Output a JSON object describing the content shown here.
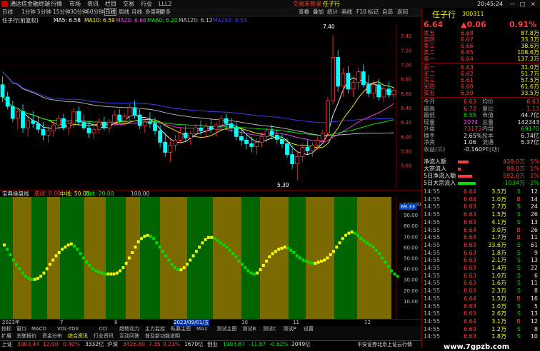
{
  "app": {
    "title": "通达信金融终端",
    "window_controls": [
      "—",
      "□",
      "×"
    ]
  },
  "menu": [
    "行情",
    "市场",
    "资讯",
    "栏目",
    "交易",
    "行业",
    "LLL2"
  ],
  "login": {
    "label": "交易未登录",
    "stock_label": "任子行"
  },
  "toolbar": {
    "items": [
      "日线",
      "1分钟",
      "5分钟",
      "15分钟",
      "30分钟",
      "60分钟",
      "日线",
      "周线",
      "月线",
      "多周期",
      "更多"
    ],
    "right_items": [
      "查看",
      "叠加",
      "统计",
      "画线",
      "F10",
      "标记",
      "自选",
      "返回"
    ]
  },
  "stock": {
    "name": "任子行",
    "code": "300311",
    "header_label": "任子行(前复权)"
  },
  "ma_legend": [
    {
      "label": "MA5: 6.58",
      "color": "#ffffff"
    },
    {
      "label": "MA10: 6.59",
      "color": "#ffff00"
    },
    {
      "label": "MA20: 6.66",
      "color": "#ff40ff"
    },
    {
      "label": "MA60: 6.20",
      "color": "#00ff00"
    },
    {
      "label": "MA120: 6.12",
      "color": "#c0c0c0"
    },
    {
      "label": "MA250: 6.54",
      "color": "#4040ff"
    }
  ],
  "price_axis": [
    "7.40",
    "7.20",
    "7.00",
    "6.80",
    "6.60",
    "6.40",
    "6.20",
    "6.00",
    "5.80",
    "5.60"
  ],
  "annotations": {
    "high": "7.40",
    "low": "5.39"
  },
  "indicator": {
    "name": "宝典操盘线",
    "legend": [
      {
        "label": "底线: 0.00",
        "color": "#ff3b3b"
      },
      {
        "label": "中线: 50.00",
        "color": "#ffff00"
      },
      {
        "label": "顶线: 20.00",
        "color": "#00ff00"
      },
      {
        "label": "100.00",
        "color": "#c0c0c0"
      }
    ],
    "axis": [
      "100.00",
      "90.00",
      "80.00",
      "70.00",
      "60.00",
      "50.00",
      "40.00",
      "30.00",
      "20.00",
      "10.00"
    ],
    "tag": "69.33"
  },
  "time_axis": {
    "labels": [
      "2023年",
      "7",
      "8",
      "2023/09/01/五",
      "10",
      "11",
      "12"
    ]
  },
  "tabs": [
    "指标",
    "窗口",
    "MACD",
    "VOL-TDX",
    "CCI",
    "趋势动力",
    "主力监控",
    "私募主图",
    "MA2",
    "测试主图",
    "测试B",
    "测试C",
    "测试P",
    "设置"
  ],
  "tabs2": [
    "扩展",
    "关联报价",
    "资金分布",
    "综合资讯",
    "行业资讯",
    "互动问答",
    "普及新功能说明"
  ],
  "quote": {
    "price": "6.64",
    "change": "▲0.06",
    "pct": "0.91%",
    "asks": [
      {
        "label": "卖五",
        "price": "6.68",
        "vol": "87.8万"
      },
      {
        "label": "卖四",
        "price": "6.67",
        "vol": "33.3万"
      },
      {
        "label": "卖三",
        "price": "6.66",
        "vol": "38.6万"
      },
      {
        "label": "卖二",
        "price": "6.65",
        "vol": "108.6万"
      },
      {
        "label": "卖一",
        "price": "6.64",
        "vol": "137.3万"
      }
    ],
    "bids": [
      {
        "label": "买一",
        "price": "6.63",
        "vol": "31.0万"
      },
      {
        "label": "买二",
        "price": "6.62",
        "vol": "51.7万"
      },
      {
        "label": "买三",
        "price": "6.61",
        "vol": "57.5万"
      },
      {
        "label": "买四",
        "price": "6.60",
        "vol": "61.6万"
      },
      {
        "label": "买五",
        "price": "6.59",
        "vol": "33.5万"
      }
    ],
    "stats": [
      {
        "l1": "今开",
        "v1": "6.63",
        "c1": "red",
        "l2": "均价",
        "v2": "6.63",
        "c2": "red"
      },
      {
        "l1": "最高",
        "v1": "6.72",
        "c1": "red",
        "l2": "量比",
        "v2": "1.13",
        "c2": "red"
      },
      {
        "l1": "最低",
        "v1": "6.55",
        "c1": "green",
        "l2": "市值",
        "v2": "44.7亿",
        "c2": "white"
      },
      {
        "l1": "现量",
        "v1": "2074",
        "c1": "mag",
        "l2": "总量",
        "v2": "142343",
        "c2": "white"
      },
      {
        "l1": "外盘",
        "v1": "73173",
        "c1": "red",
        "l2": "内盘",
        "v2": "69170",
        "c2": "green"
      },
      {
        "l1": "换手",
        "v1": "2.65%",
        "c1": "white",
        "l2": "股本",
        "v2": "6.74亿",
        "c2": "white"
      },
      {
        "l1": "净资",
        "v1": "1.06",
        "c1": "white",
        "l2": "流通",
        "v2": "5.37亿",
        "c2": "white"
      },
      {
        "l1": "收益(三)",
        "v1": "-0.160",
        "c1": "white",
        "l2": "PE(动)",
        "v2": "",
        "c2": "white"
      }
    ],
    "flows": [
      {
        "label": "净流入额",
        "value": "438.0万",
        "pct": "5%",
        "color": "#ff3b3b",
        "frac": 0.55
      },
      {
        "label": "大宗流入",
        "value": "98.0万",
        "pct": "1%",
        "color": "#ff3b3b",
        "frac": 0.15
      },
      {
        "label": "5日净流入额",
        "value": "592.6万",
        "pct": "1%",
        "color": "#ff3b3b",
        "frac": 0.7
      },
      {
        "label": "5日大宗流入",
        "value": "-1034万",
        "pct": "-2%",
        "color": "#00e000",
        "frac": 0.9
      }
    ]
  },
  "ticks": [
    {
      "t": "14:55",
      "p": "6.64",
      "v": "3.5万",
      "d": "S",
      "n": "12"
    },
    {
      "t": "14:55",
      "p": "6.64",
      "v": "1.0万",
      "d": "B",
      "n": "14"
    },
    {
      "t": "14:55",
      "p": "6.63",
      "v": "2.7万",
      "d": "S",
      "n": "24"
    },
    {
      "t": "14:55",
      "p": "6.63",
      "v": "1.5万",
      "d": "S",
      "n": "26"
    },
    {
      "t": "14:55",
      "p": "6.63",
      "v": "4.1万",
      "d": "S",
      "n": "13"
    },
    {
      "t": "14:55",
      "p": "6.64",
      "v": "3.0万",
      "d": "B",
      "n": "26"
    },
    {
      "t": "14:55",
      "p": "6.64",
      "v": "1.7万",
      "d": "B",
      "n": "11"
    },
    {
      "t": "14:55",
      "p": "6.63",
      "v": "33.6万",
      "d": "S",
      "n": "61"
    },
    {
      "t": "14:55",
      "p": "6.63",
      "v": "1.8万",
      "d": "S",
      "n": "9"
    },
    {
      "t": "14:55",
      "p": "6.63",
      "v": "2.1万",
      "d": "S",
      "n": "13"
    },
    {
      "t": "14:55",
      "p": "6.63",
      "v": "1.4万",
      "d": "S",
      "n": "22"
    },
    {
      "t": "14:55",
      "p": "6.63",
      "v": "1.0万",
      "d": "S",
      "n": "6"
    },
    {
      "t": "14:55",
      "p": "6.63",
      "v": "1.6万",
      "d": "S",
      "n": "11"
    },
    {
      "t": "14:55",
      "p": "6.63",
      "v": "2.3万",
      "d": "S",
      "n": "8"
    },
    {
      "t": "14:55",
      "p": "6.64",
      "v": "1.5万",
      "d": "B",
      "n": "16"
    },
    {
      "t": "14:55",
      "p": "6.63",
      "v": "1.0万",
      "d": "S",
      "n": "5"
    },
    {
      "t": "14:55",
      "p": "6.63",
      "v": "2.6万",
      "d": "S",
      "n": "13"
    },
    {
      "t": "14:55",
      "p": "6.64",
      "v": "3.1万",
      "d": "B",
      "n": "12"
    },
    {
      "t": "14:55",
      "p": "6.63",
      "v": "1.2万",
      "d": "S",
      "n": "8"
    },
    {
      "t": "14:55",
      "p": "6.63",
      "v": "1.8万",
      "d": "S",
      "n": "10"
    }
  ],
  "index_bar": [
    {
      "name": "上证",
      "value": "3003.44",
      "chg": "12.00",
      "pct": "0.40%",
      "amt": "3332亿"
    },
    {
      "name": "沪深",
      "value": "3426.80",
      "chg": "7.35",
      "pct": "0.21%",
      "amt": "1670亿"
    },
    {
      "name": "创业",
      "value": "1903.87",
      "chg": "-11.87",
      "pct": "-0.62%",
      "amt": "2049亿"
    }
  ],
  "status": {
    "server": "平安证券北京上证云行情",
    "watermark": "www.7gpzb.com"
  },
  "time": "20:45:24",
  "chart_data": {
    "type": "candlestick",
    "ylim": [
      5.3,
      7.5
    ],
    "ohlc": [
      [
        6.72,
        6.84,
        6.48,
        6.55
      ],
      [
        6.55,
        6.62,
        6.38,
        6.42
      ],
      [
        6.42,
        6.5,
        6.2,
        6.25
      ],
      [
        6.25,
        6.4,
        6.1,
        6.35
      ],
      [
        6.35,
        6.45,
        6.05,
        6.12
      ],
      [
        6.12,
        6.3,
        6.0,
        6.22
      ],
      [
        6.22,
        6.35,
        6.12,
        6.18
      ],
      [
        6.18,
        6.28,
        6.05,
        6.1
      ],
      [
        6.1,
        6.2,
        5.95,
        6.02
      ],
      [
        6.02,
        6.15,
        5.92,
        6.08
      ],
      [
        6.08,
        6.22,
        6.0,
        6.16
      ],
      [
        6.16,
        6.3,
        6.1,
        6.25
      ],
      [
        6.25,
        6.32,
        6.08,
        6.12
      ],
      [
        6.12,
        6.22,
        6.02,
        6.18
      ],
      [
        6.18,
        6.4,
        6.12,
        6.35
      ],
      [
        6.35,
        6.42,
        6.15,
        6.2
      ],
      [
        6.2,
        6.3,
        6.08,
        6.12
      ],
      [
        6.12,
        6.2,
        5.98,
        6.05
      ],
      [
        6.05,
        6.18,
        5.96,
        6.1
      ],
      [
        6.1,
        6.25,
        6.04,
        6.2
      ],
      [
        6.2,
        6.28,
        6.08,
        6.12
      ],
      [
        6.12,
        6.24,
        6.05,
        6.2
      ],
      [
        6.2,
        6.36,
        6.14,
        6.3
      ],
      [
        6.3,
        6.38,
        6.18,
        6.22
      ],
      [
        6.22,
        6.32,
        6.15,
        6.28
      ],
      [
        6.28,
        6.45,
        6.22,
        6.4
      ],
      [
        6.4,
        6.5,
        6.25,
        6.3
      ],
      [
        6.3,
        6.38,
        6.1,
        6.15
      ],
      [
        6.15,
        6.25,
        6.05,
        6.2
      ],
      [
        6.2,
        6.34,
        6.12,
        6.18
      ],
      [
        6.18,
        6.26,
        6.02,
        6.08
      ],
      [
        6.08,
        6.16,
        5.85,
        5.92
      ],
      [
        5.92,
        6.05,
        5.72,
        5.78
      ],
      [
        5.78,
        5.95,
        5.65,
        5.88
      ],
      [
        5.88,
        6.02,
        5.8,
        5.95
      ],
      [
        5.95,
        6.12,
        5.9,
        6.05
      ],
      [
        6.05,
        6.15,
        5.92,
        5.98
      ],
      [
        5.98,
        6.08,
        5.88,
        6.04
      ],
      [
        6.04,
        6.18,
        5.98,
        6.12
      ],
      [
        6.12,
        6.22,
        6.02,
        6.08
      ],
      [
        6.08,
        6.18,
        5.98,
        6.14
      ],
      [
        6.14,
        6.24,
        6.05,
        6.1
      ],
      [
        6.1,
        6.2,
        6.0,
        6.16
      ],
      [
        6.16,
        6.3,
        6.1,
        6.25
      ],
      [
        6.25,
        6.32,
        6.12,
        6.18
      ],
      [
        6.18,
        6.26,
        6.06,
        6.12
      ],
      [
        6.12,
        6.2,
        5.95,
        6.0
      ],
      [
        6.0,
        6.1,
        5.88,
        5.95
      ],
      [
        5.95,
        6.04,
        5.82,
        5.9
      ],
      [
        5.9,
        6.0,
        5.78,
        5.86
      ],
      [
        5.86,
        5.98,
        5.75,
        5.92
      ],
      [
        5.92,
        6.06,
        5.85,
        6.0
      ],
      [
        6.0,
        6.12,
        5.92,
        6.08
      ],
      [
        6.08,
        6.16,
        5.96,
        6.02
      ],
      [
        6.02,
        6.1,
        5.9,
        5.96
      ],
      [
        5.96,
        6.04,
        5.84,
        5.9
      ],
      [
        5.9,
        5.98,
        5.7,
        5.75
      ],
      [
        5.75,
        5.88,
        5.55,
        5.62
      ],
      [
        5.62,
        5.8,
        5.39,
        5.72
      ],
      [
        5.72,
        5.9,
        5.65,
        5.85
      ],
      [
        5.85,
        5.95,
        5.75,
        5.8
      ],
      [
        5.8,
        5.92,
        5.72,
        5.88
      ],
      [
        5.88,
        6.0,
        5.82,
        5.95
      ],
      [
        5.95,
        6.1,
        5.9,
        6.05
      ],
      [
        6.05,
        6.55,
        6.0,
        6.5
      ],
      [
        6.5,
        7.4,
        6.45,
        7.1
      ],
      [
        7.1,
        7.2,
        6.62,
        6.7
      ],
      [
        6.7,
        6.95,
        6.55,
        6.88
      ],
      [
        6.88,
        6.98,
        6.6,
        6.66
      ],
      [
        6.66,
        6.8,
        6.55,
        6.75
      ],
      [
        6.75,
        6.95,
        6.65,
        6.9
      ],
      [
        6.9,
        7.0,
        6.68,
        6.72
      ],
      [
        6.72,
        6.85,
        6.55,
        6.6
      ],
      [
        6.6,
        6.78,
        6.52,
        6.72
      ],
      [
        6.72,
        6.8,
        6.5,
        6.55
      ],
      [
        6.55,
        6.7,
        6.48,
        6.66
      ],
      [
        6.66,
        6.76,
        6.54,
        6.58
      ],
      [
        6.58,
        6.68,
        6.52,
        6.64
      ]
    ],
    "osc": [
      62,
      58,
      53,
      48,
      44,
      40,
      36,
      33,
      31,
      30,
      30,
      31,
      33,
      36,
      40,
      44,
      48,
      52,
      55,
      58,
      60,
      62,
      63,
      61,
      58,
      54,
      50,
      46,
      43,
      40,
      38,
      37,
      36,
      35,
      35,
      35,
      35,
      36,
      38,
      41,
      45,
      50,
      55,
      60,
      65,
      68,
      70,
      71,
      70,
      68,
      64,
      60,
      56,
      52,
      48,
      44,
      41,
      39,
      39,
      41,
      44,
      48,
      52,
      56,
      60,
      64,
      67,
      69,
      69,
      68,
      66,
      64,
      62,
      60,
      57,
      54,
      51,
      47,
      44,
      41,
      38,
      36,
      35,
      36,
      39,
      43,
      47,
      51,
      54,
      56,
      58,
      59,
      60,
      59,
      57,
      55,
      52,
      50,
      48,
      47,
      46,
      45,
      45,
      46,
      47,
      48,
      50,
      53,
      56,
      60,
      64,
      68,
      71,
      73,
      74,
      73,
      71,
      68,
      66,
      64,
      62,
      60,
      57,
      54,
      50,
      46,
      42,
      38,
      35,
      33
    ]
  }
}
